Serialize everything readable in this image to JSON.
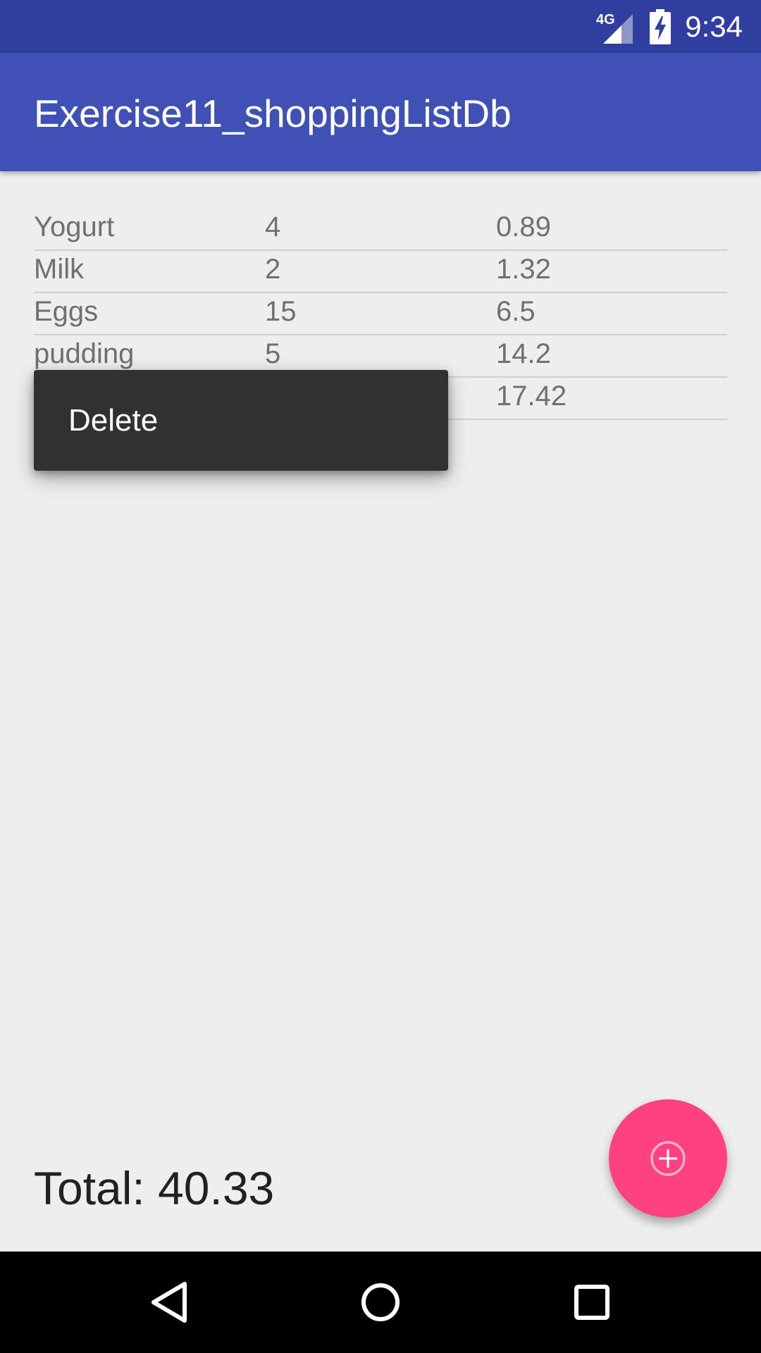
{
  "status_bar": {
    "network": "4G",
    "time": "9:34"
  },
  "app_bar": {
    "title": "Exercise11_shoppingListDb"
  },
  "items": [
    {
      "name": "Yogurt",
      "quantity": "4",
      "price": "0.89"
    },
    {
      "name": "Milk",
      "quantity": "2",
      "price": "1.32"
    },
    {
      "name": "Eggs",
      "quantity": "15",
      "price": "6.5"
    },
    {
      "name": "pudding",
      "quantity": "5",
      "price": "14.2"
    },
    {
      "name": "",
      "quantity": "",
      "price": "17.42"
    }
  ],
  "context_menu": {
    "delete_label": "Delete"
  },
  "total": {
    "label": "Total: 40.33"
  },
  "icons": {
    "fab": "add-circle-icon",
    "nav_back": "back-triangle-icon",
    "nav_home": "home-circle-icon",
    "nav_recents": "recents-square-icon"
  },
  "colors": {
    "status_bar": "#303f9f",
    "app_bar": "#3f51b5",
    "fab": "#ff4081",
    "menu": "#313131",
    "background": "#eeeeee"
  }
}
